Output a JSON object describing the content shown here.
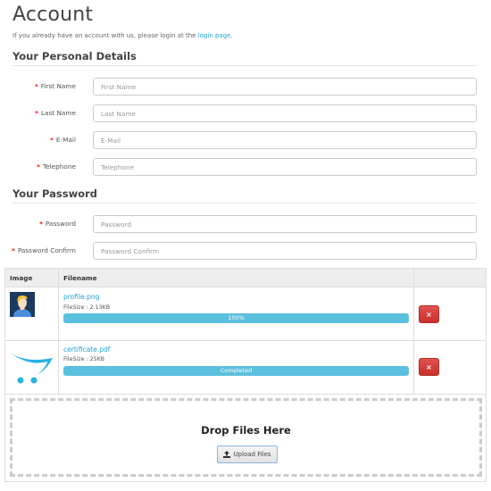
{
  "page": {
    "title": "Account",
    "intro_text": "If you already have an account with us, please login at the ",
    "intro_link": "login page",
    "intro_end": "."
  },
  "personal": {
    "heading": "Your Personal Details",
    "fields": [
      {
        "label": "First Name",
        "placeholder": "First Name",
        "value": "",
        "required": true
      },
      {
        "label": "Last Name",
        "placeholder": "Last Name",
        "value": "",
        "required": true
      },
      {
        "label": "E-Mail",
        "placeholder": "E-Mail",
        "value": "",
        "required": true
      },
      {
        "label": "Telephone",
        "placeholder": "Telephone",
        "value": "",
        "required": true
      }
    ]
  },
  "password": {
    "heading": "Your Password",
    "fields": [
      {
        "label": "Password",
        "placeholder": "Password",
        "value": "",
        "required": true
      },
      {
        "label": "Password Confirm",
        "placeholder": "Password Confirm",
        "value": "",
        "required": true
      }
    ]
  },
  "required_marker": "*",
  "uploads": {
    "columns": [
      "Image",
      "Filename",
      ""
    ],
    "files": [
      {
        "thumbnail": "user-avatar-icon",
        "name": "profile.png",
        "size": "FileSize : 2.13KB",
        "progress": 100,
        "progress_label": "100%",
        "remove_icon": "×"
      },
      {
        "thumbnail": "opencart-logo",
        "name": "certificate.pdf",
        "size": "FileSize : 25KB",
        "progress": 100,
        "progress_label": "Completed",
        "remove_icon": "×"
      }
    ],
    "dropzone": {
      "title": "Drop Files Here",
      "button_label": "Upload Files",
      "button_icon": "upload-icon"
    },
    "colors": {
      "progress": "#5bc0de",
      "danger": "#d9534f",
      "link": "#23a1d1"
    }
  }
}
